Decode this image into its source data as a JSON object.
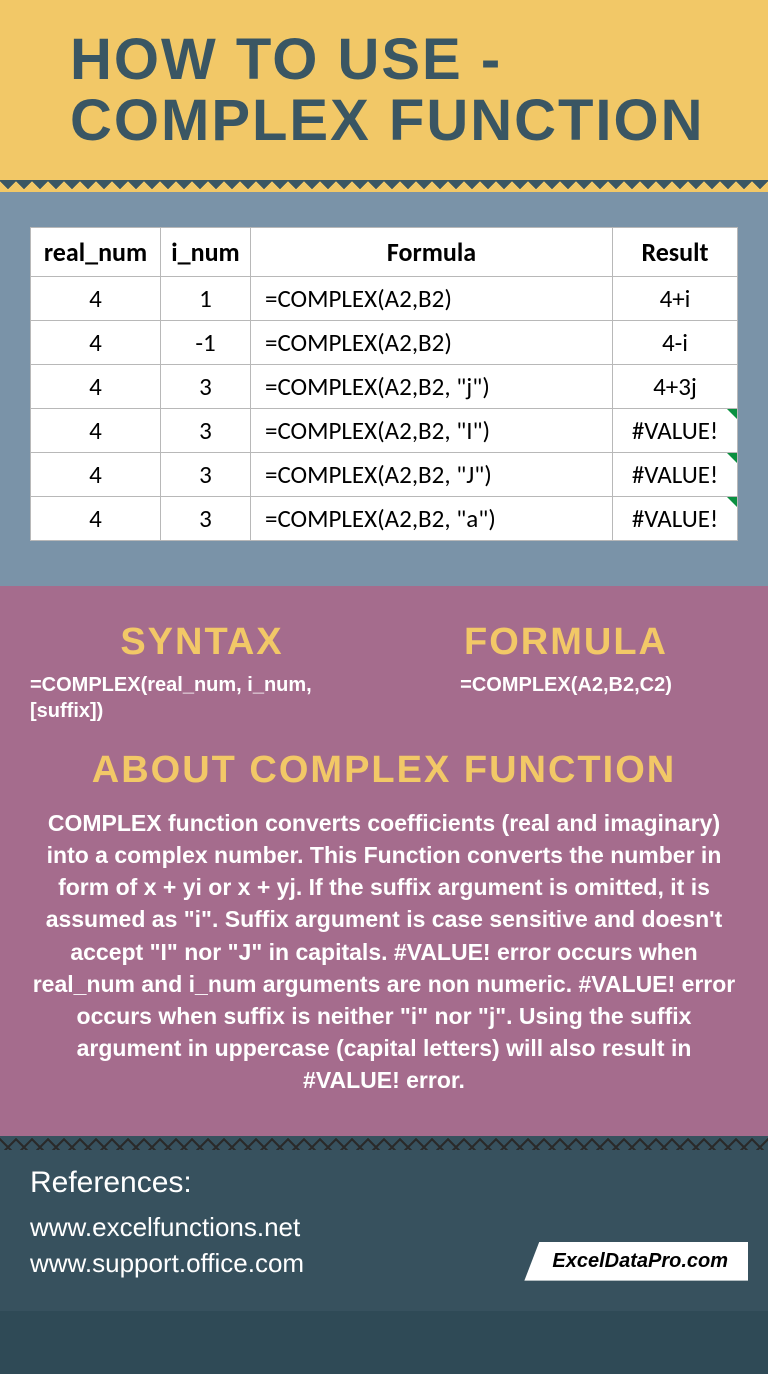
{
  "header": {
    "title_line1": "HOW TO USE -",
    "title_line2": "COMPLEX FUNCTION"
  },
  "table": {
    "headers": [
      "real_num",
      "i_num",
      "Formula",
      "Result"
    ],
    "rows": [
      {
        "real_num": "4",
        "i_num": "1",
        "formula": "=COMPLEX(A2,B2)",
        "result": "4+i",
        "error": false
      },
      {
        "real_num": "4",
        "i_num": "-1",
        "formula": "=COMPLEX(A2,B2)",
        "result": "4-i",
        "error": false
      },
      {
        "real_num": "4",
        "i_num": "3",
        "formula": "=COMPLEX(A2,B2, \"j\")",
        "result": "4+3j",
        "error": false
      },
      {
        "real_num": "4",
        "i_num": "3",
        "formula": "=COMPLEX(A2,B2, \"I\")",
        "result": "#VALUE!",
        "error": true
      },
      {
        "real_num": "4",
        "i_num": "3",
        "formula": "=COMPLEX(A2,B2, \"J\")",
        "result": "#VALUE!",
        "error": true
      },
      {
        "real_num": "4",
        "i_num": "3",
        "formula": "=COMPLEX(A2,B2, \"a\")",
        "result": "#VALUE!",
        "error": true
      }
    ]
  },
  "syntax": {
    "heading": "SYNTAX",
    "body": "=COMPLEX(real_num, i_num, [suffix])"
  },
  "formula": {
    "heading": "FORMULA",
    "body": "=COMPLEX(A2,B2,C2)"
  },
  "about": {
    "heading": "ABOUT COMPLEX FUNCTION",
    "body": "COMPLEX function converts coefficients (real and imaginary) into a complex number. This Function converts the number in form of x + yi or x + yj. If the suffix argument is omitted,  it is assumed as \"i\". Suffix argument is case sensitive and doesn't accept \"I\" nor \"J\" in capitals. #VALUE! error occurs when real_num and i_num arguments are non numeric. #VALUE! error occurs when suffix is neither \"i\" nor \"j\". Using the suffix argument in uppercase (capital letters) will also result in #VALUE! error."
  },
  "footer": {
    "heading": "References:",
    "refs": [
      "www.excelfunctions.net",
      "www.support.office.com"
    ],
    "brand": "ExcelDataPro.com"
  }
}
